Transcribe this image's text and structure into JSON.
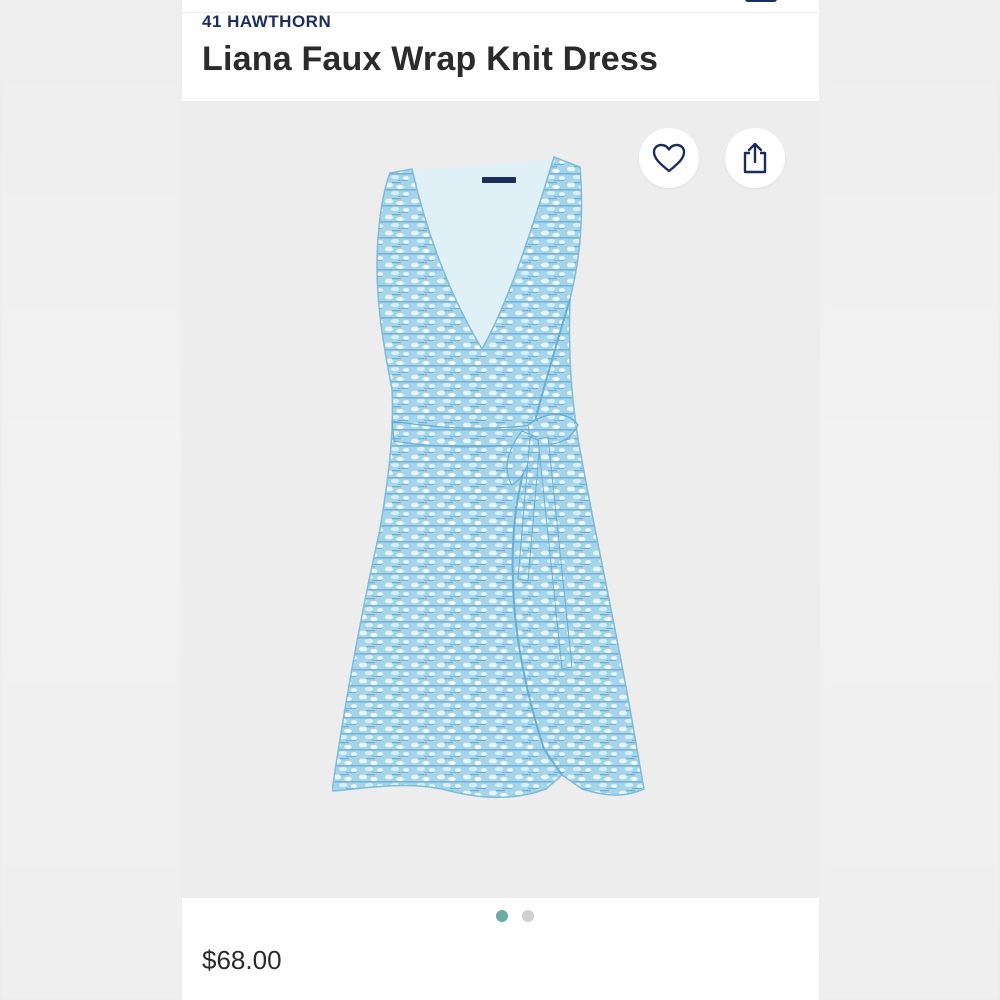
{
  "product": {
    "brand": "41 HAWTHORN",
    "title": "Liana Faux Wrap Knit Dress",
    "price": "$68.00"
  },
  "actions": {
    "favorite_icon": "heart-icon",
    "share_icon": "share-icon"
  },
  "carousel": {
    "total": 2,
    "active_index": 0,
    "active_color": "#6aaea2",
    "inactive_color": "#cfcfcf"
  },
  "colors": {
    "brand": "#1d2d5a",
    "text": "#2b2b2b",
    "image_bg": "#ededee",
    "dress_base": "#9fd0e6",
    "dress_dark": "#5ea9cf",
    "dress_light": "#e8f6fb"
  }
}
